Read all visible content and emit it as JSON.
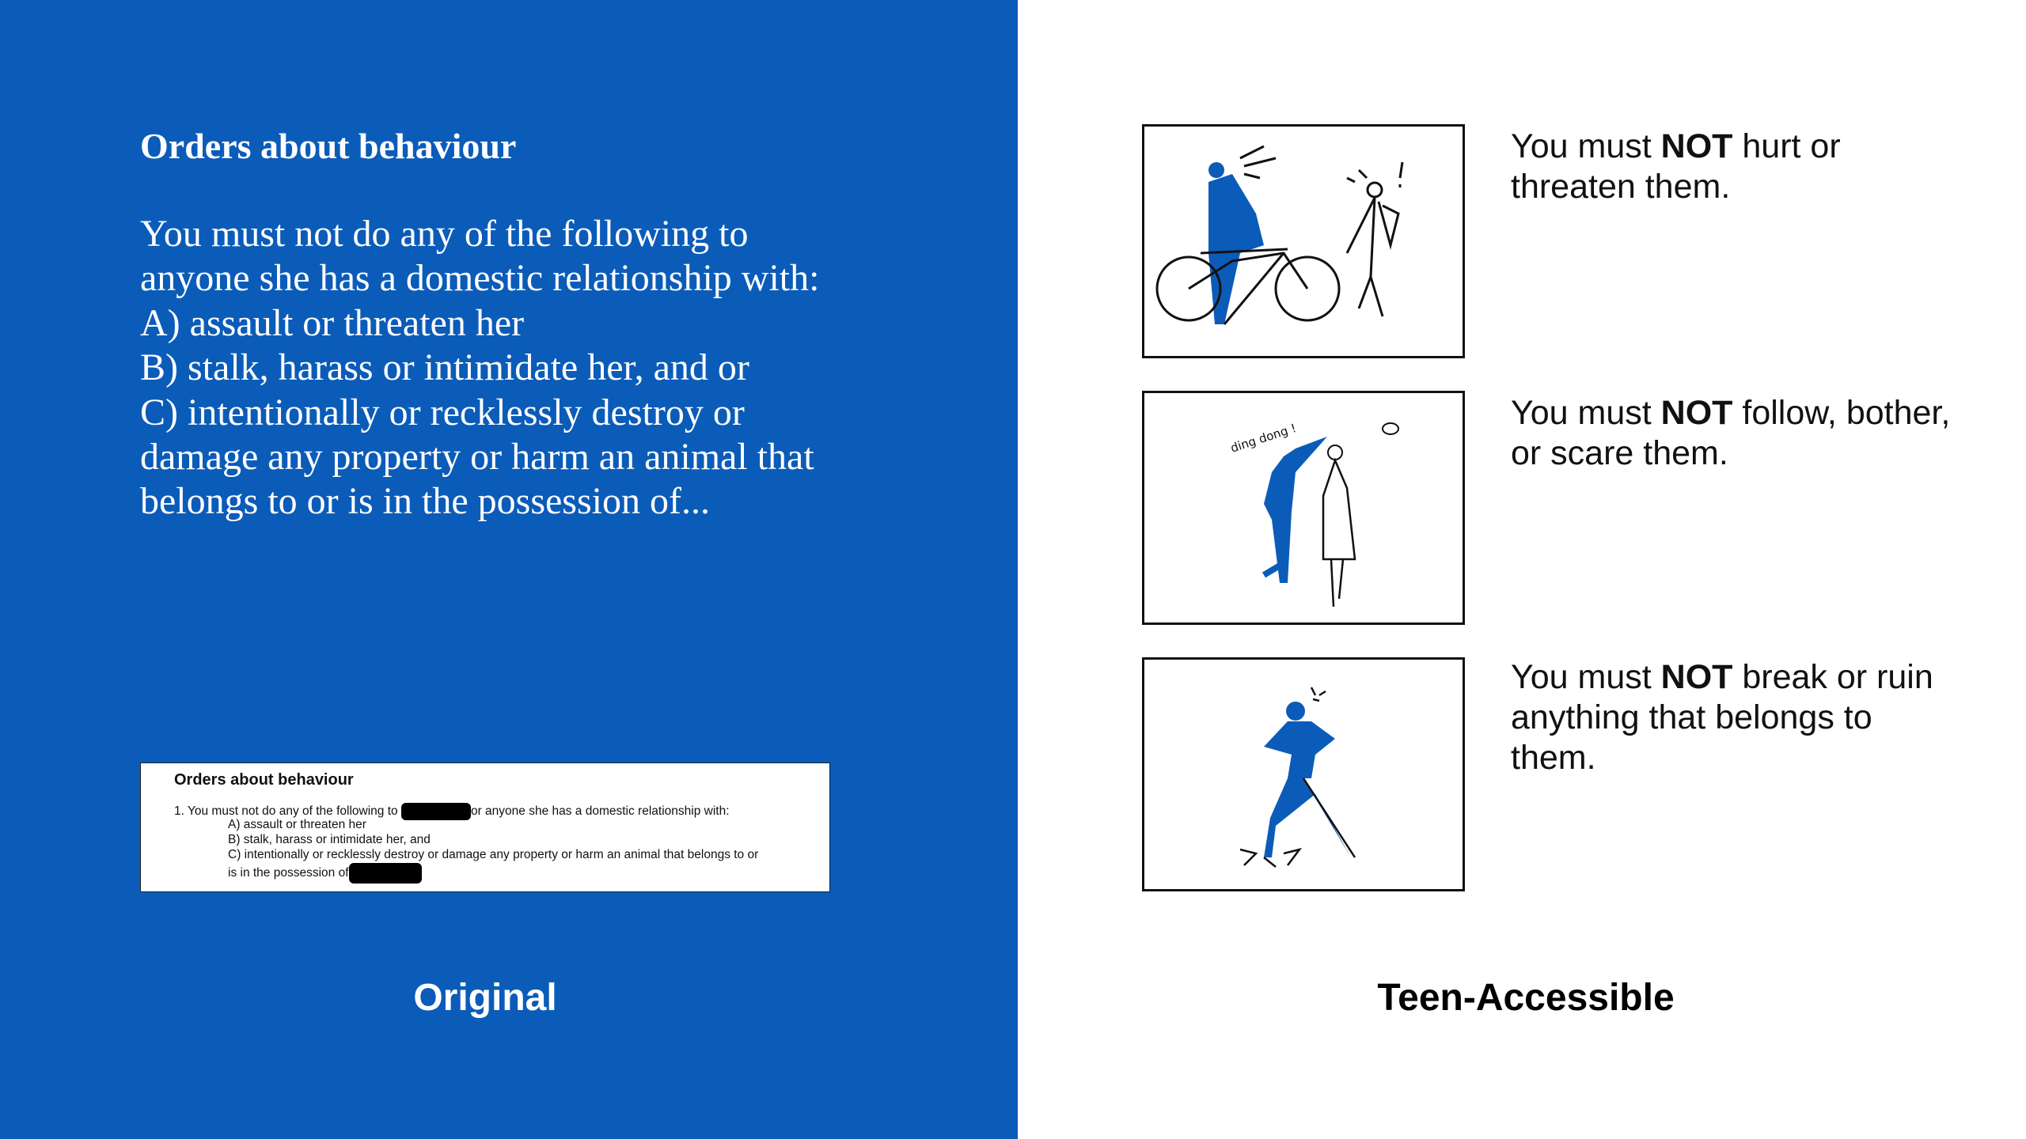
{
  "original": {
    "title": "Orders about behaviour",
    "body_lines": [
      "You must not do any of the following to",
      "anyone she has a domestic relationship with:",
      "A) assault or threaten her",
      "B) stalk, harass or intimidate her, and or",
      "C) intentionally or recklessly destroy or",
      "damage any property or harm an animal that",
      "belongs to or is in the possession of..."
    ],
    "scan": {
      "title": "Orders about behaviour",
      "line1_a": "1.  You must not do any of the following to",
      "line1_b": "or anyone she has a domestic relationship with:",
      "item_a": "A)  assault or threaten her",
      "item_b": "B)  stalk, harass or intimidate her, and",
      "item_c": "C)  intentionally or recklessly destroy or damage any property or harm an animal that belongs to or",
      "item_c2": "is in the possession of"
    },
    "caption": "Original"
  },
  "teen": {
    "items": [
      {
        "prefix": "You must ",
        "bold": "NOT",
        "suffix": " hurt or threaten them.",
        "illustration": "cyclist-threatening-person-sketch"
      },
      {
        "prefix": "You must ",
        "bold": "NOT",
        "suffix": " follow, bother, or scare them.",
        "illustration": "person-ringing-doorbell-sketch",
        "sketch_text": "ding dong !"
      },
      {
        "prefix": "You must ",
        "bold": "NOT",
        "suffix": " break or ruin anything that belongs to them.",
        "illustration": "angry-person-stomping-sketch"
      }
    ],
    "caption": "Teen-Accessible"
  },
  "colors": {
    "brand_blue": "#0b5cb9",
    "text_dark": "#111111"
  }
}
